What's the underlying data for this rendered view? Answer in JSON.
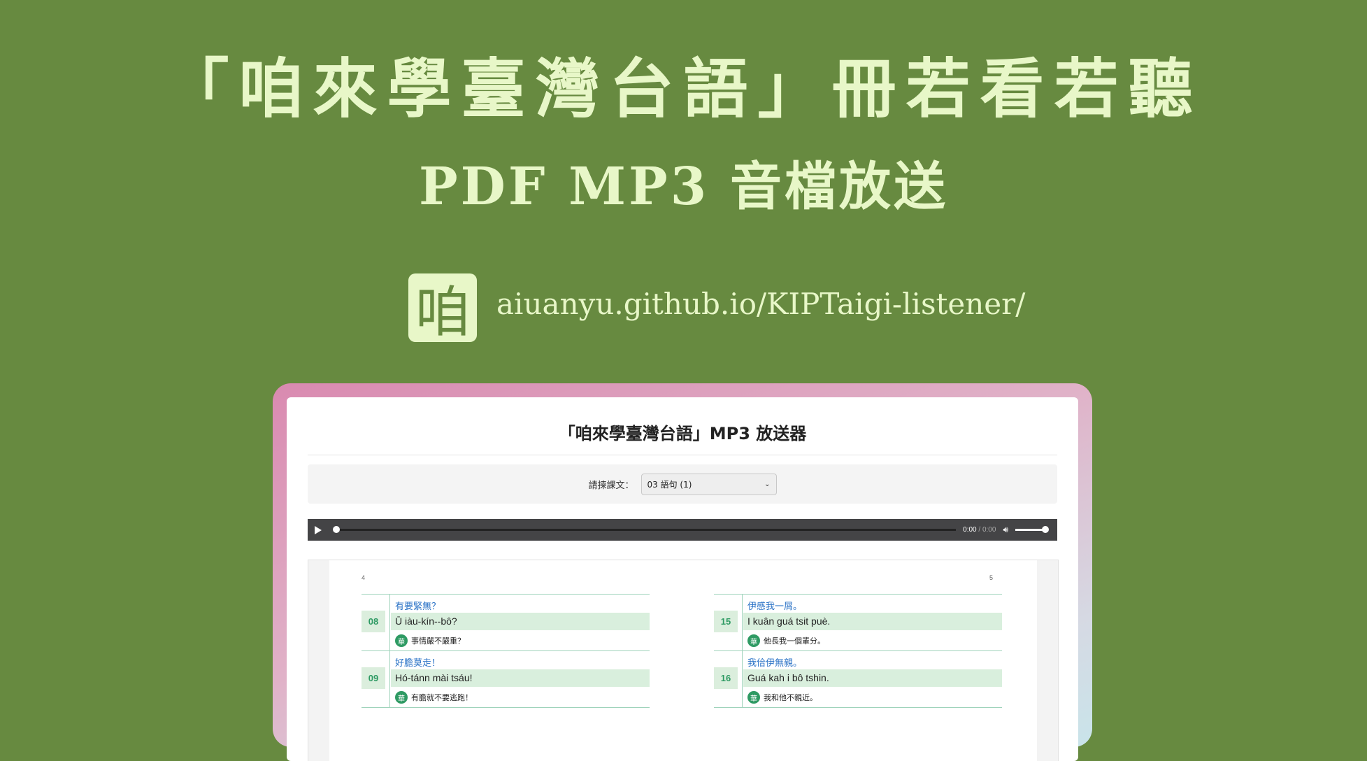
{
  "hero": {
    "title": "「咱來學臺灣台語」冊若看若聽",
    "subtitle": "PDF MP3 音檔放送",
    "logo_char": "咱",
    "url": "aiuanyu.github.io/KIPTaigi-listener/"
  },
  "app": {
    "title": "「咱來學臺灣台語」MP3 放送器",
    "selector_label": "請揀課文：",
    "selected_lesson": "03 語句 (1)",
    "audio": {
      "current_time": "0:00",
      "separator": " / ",
      "duration": "0:00",
      "progress": 0,
      "volume": 1
    },
    "pdf": {
      "left_page_number": "4",
      "right_page_number": "5",
      "left_rows": [
        {
          "num": "08",
          "hanji": "有要緊無？",
          "lomaji": "Ū iàu-kín--bô?",
          "badge": "華",
          "zh": "事情嚴不嚴重？"
        },
        {
          "num": "09",
          "hanji": "好膽莫走！",
          "lomaji": "Hó-tánn mài tsáu!",
          "badge": "華",
          "zh": "有膽就不要逃跑！"
        }
      ],
      "right_rows": [
        {
          "num": "15",
          "hanji": "伊慼我一屑。",
          "lomaji": "I kuân guá tsit puè.",
          "badge": "華",
          "zh": "他長我一個輩分。"
        },
        {
          "num": "16",
          "hanji": "我佮伊無親。",
          "lomaji": "Guá kah i bô tshin.",
          "badge": "華",
          "zh": "我和他不親近。"
        }
      ]
    }
  },
  "colors": {
    "background": "#678a40",
    "hero_text": "#e8f7c8",
    "accent_green": "#2e9a63",
    "hanji_blue": "#2a72c6"
  },
  "icons": [
    "play-icon",
    "volume-icon",
    "chevron-down-icon"
  ]
}
